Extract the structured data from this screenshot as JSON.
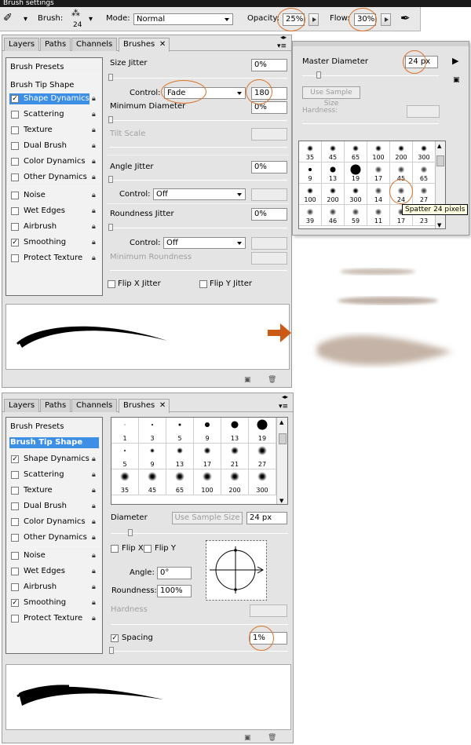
{
  "window_title": "Brush settings",
  "options_bar": {
    "brush_label": "Brush:",
    "brush_size": "24",
    "mode_label": "Mode:",
    "mode_value": "Normal",
    "opacity_label": "Opacity:",
    "opacity_value": "25%",
    "flow_label": "Flow:",
    "flow_value": "30%"
  },
  "panel_tabs": [
    "Layers",
    "Paths",
    "Channels",
    "Brushes"
  ],
  "top_panel": {
    "list": [
      {
        "label": "Brush Presets",
        "checkbox": false
      },
      {
        "label": "Brush Tip Shape",
        "checkbox": false
      },
      {
        "label": "Shape Dynamics",
        "checkbox": true,
        "checked": true,
        "selected": true
      },
      {
        "label": "Scattering",
        "checkbox": true,
        "checked": false
      },
      {
        "label": "Texture",
        "checkbox": true,
        "checked": false
      },
      {
        "label": "Dual Brush",
        "checkbox": true,
        "checked": false
      },
      {
        "label": "Color Dynamics",
        "checkbox": true,
        "checked": false
      },
      {
        "label": "Other Dynamics",
        "checkbox": true,
        "checked": false
      },
      {
        "label": "Noise",
        "checkbox": true,
        "checked": false
      },
      {
        "label": "Wet Edges",
        "checkbox": true,
        "checked": false
      },
      {
        "label": "Airbrush",
        "checkbox": true,
        "checked": false
      },
      {
        "label": "Smoothing",
        "checkbox": true,
        "checked": true
      },
      {
        "label": "Protect Texture",
        "checkbox": true,
        "checked": false
      }
    ],
    "size_jitter_label": "Size Jitter",
    "size_jitter_value": "0%",
    "control_label": "Control:",
    "control_value": "Fade",
    "fade_steps": "180",
    "min_diameter_label": "Minimum Diameter",
    "min_diameter_value": "0%",
    "tilt_scale_label": "Tilt Scale",
    "angle_jitter_label": "Angle Jitter",
    "angle_jitter_value": "0%",
    "angle_control_value": "Off",
    "roundness_jitter_label": "Roundness Jitter",
    "roundness_jitter_value": "0%",
    "roundness_control_value": "Off",
    "min_roundness_label": "Minimum Roundness",
    "flip_x_jitter": "Flip X Jitter",
    "flip_y_jitter": "Flip Y Jitter"
  },
  "picker_panel": {
    "master_diameter_label": "Master Diameter",
    "master_diameter_value": "24 px",
    "use_sample_size": "Use Sample Size",
    "hardness_label": "Hardness:",
    "tooltip": "Spatter 24 pixels",
    "brush_rows": [
      [
        "35",
        "45",
        "65",
        "100",
        "200",
        "300"
      ],
      [
        "9",
        "13",
        "19",
        "17",
        "45",
        "65"
      ],
      [
        "100",
        "200",
        "300",
        "14",
        "24",
        "27"
      ],
      [
        "39",
        "46",
        "59",
        "11",
        "17",
        "23"
      ]
    ]
  },
  "bottom_panel": {
    "list": [
      {
        "label": "Brush Presets",
        "checkbox": false
      },
      {
        "label": "Brush Tip Shape",
        "checkbox": false,
        "selected": true
      },
      {
        "label": "Shape Dynamics",
        "checkbox": true,
        "checked": true
      },
      {
        "label": "Scattering",
        "checkbox": true,
        "checked": false
      },
      {
        "label": "Texture",
        "checkbox": true,
        "checked": false
      },
      {
        "label": "Dual Brush",
        "checkbox": true,
        "checked": false
      },
      {
        "label": "Color Dynamics",
        "checkbox": true,
        "checked": false
      },
      {
        "label": "Other Dynamics",
        "checkbox": true,
        "checked": false
      },
      {
        "label": "Noise",
        "checkbox": true,
        "checked": false
      },
      {
        "label": "Wet Edges",
        "checkbox": true,
        "checked": false
      },
      {
        "label": "Airbrush",
        "checkbox": true,
        "checked": false
      },
      {
        "label": "Smoothing",
        "checkbox": true,
        "checked": true
      },
      {
        "label": "Protect Texture",
        "checkbox": true,
        "checked": false
      }
    ],
    "brush_rows": [
      [
        "1",
        "3",
        "5",
        "9",
        "13",
        "19"
      ],
      [
        "5",
        "9",
        "13",
        "17",
        "21",
        "27"
      ],
      [
        "35",
        "45",
        "65",
        "100",
        "200",
        "300"
      ]
    ],
    "diameter_label": "Diameter",
    "use_sample_size": "Use Sample Size",
    "diameter_value": "24 px",
    "flip_x": "Flip X",
    "flip_y": "Flip Y",
    "angle_label": "Angle:",
    "angle_value": "0°",
    "roundness_label": "Roundness:",
    "roundness_value": "100%",
    "hardness_label": "Hardness",
    "spacing_label": "Spacing",
    "spacing_value": "1%"
  },
  "colors": {
    "accent_circle": "#d9732a",
    "arrow": "#cc5a14",
    "selected_item": "#3d8fe6"
  }
}
